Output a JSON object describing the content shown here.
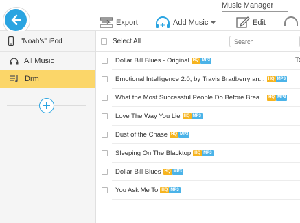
{
  "window": {
    "title": "Music Manager"
  },
  "toolbar": {
    "export_label": "Export",
    "add_music_label": "Add Music",
    "edit_label": "Edit"
  },
  "sidebar": {
    "device_name": "\"Noah's\" iPod",
    "items": [
      {
        "label": "All Music",
        "icon": "headphones-icon"
      },
      {
        "label": "Drm",
        "icon": "playlist-icon",
        "active": true
      }
    ]
  },
  "list": {
    "select_all_label": "Select All",
    "search_placeholder": "Search",
    "partial_column_label": "To",
    "badge_hq": "HQ",
    "badge_mp3": "MP3",
    "rows": [
      {
        "title": "Dollar Bill Blues - Original"
      },
      {
        "title": "Emotional Intelligence 2.0, by Travis Bradberry an..."
      },
      {
        "title": "What the Most Successful People Do Before Brea..."
      },
      {
        "title": "Love The Way You Lie"
      },
      {
        "title": "Dust of the Chase"
      },
      {
        "title": "Sleeping On The Blacktop"
      },
      {
        "title": "Dollar Bill Blues"
      },
      {
        "title": "You Ask Me To"
      }
    ]
  },
  "colors": {
    "accent": "#2aa4e1",
    "active_bg": "#fbd669",
    "hq_badge": "#f6b41f",
    "mp3_badge": "#4bb3e8"
  }
}
